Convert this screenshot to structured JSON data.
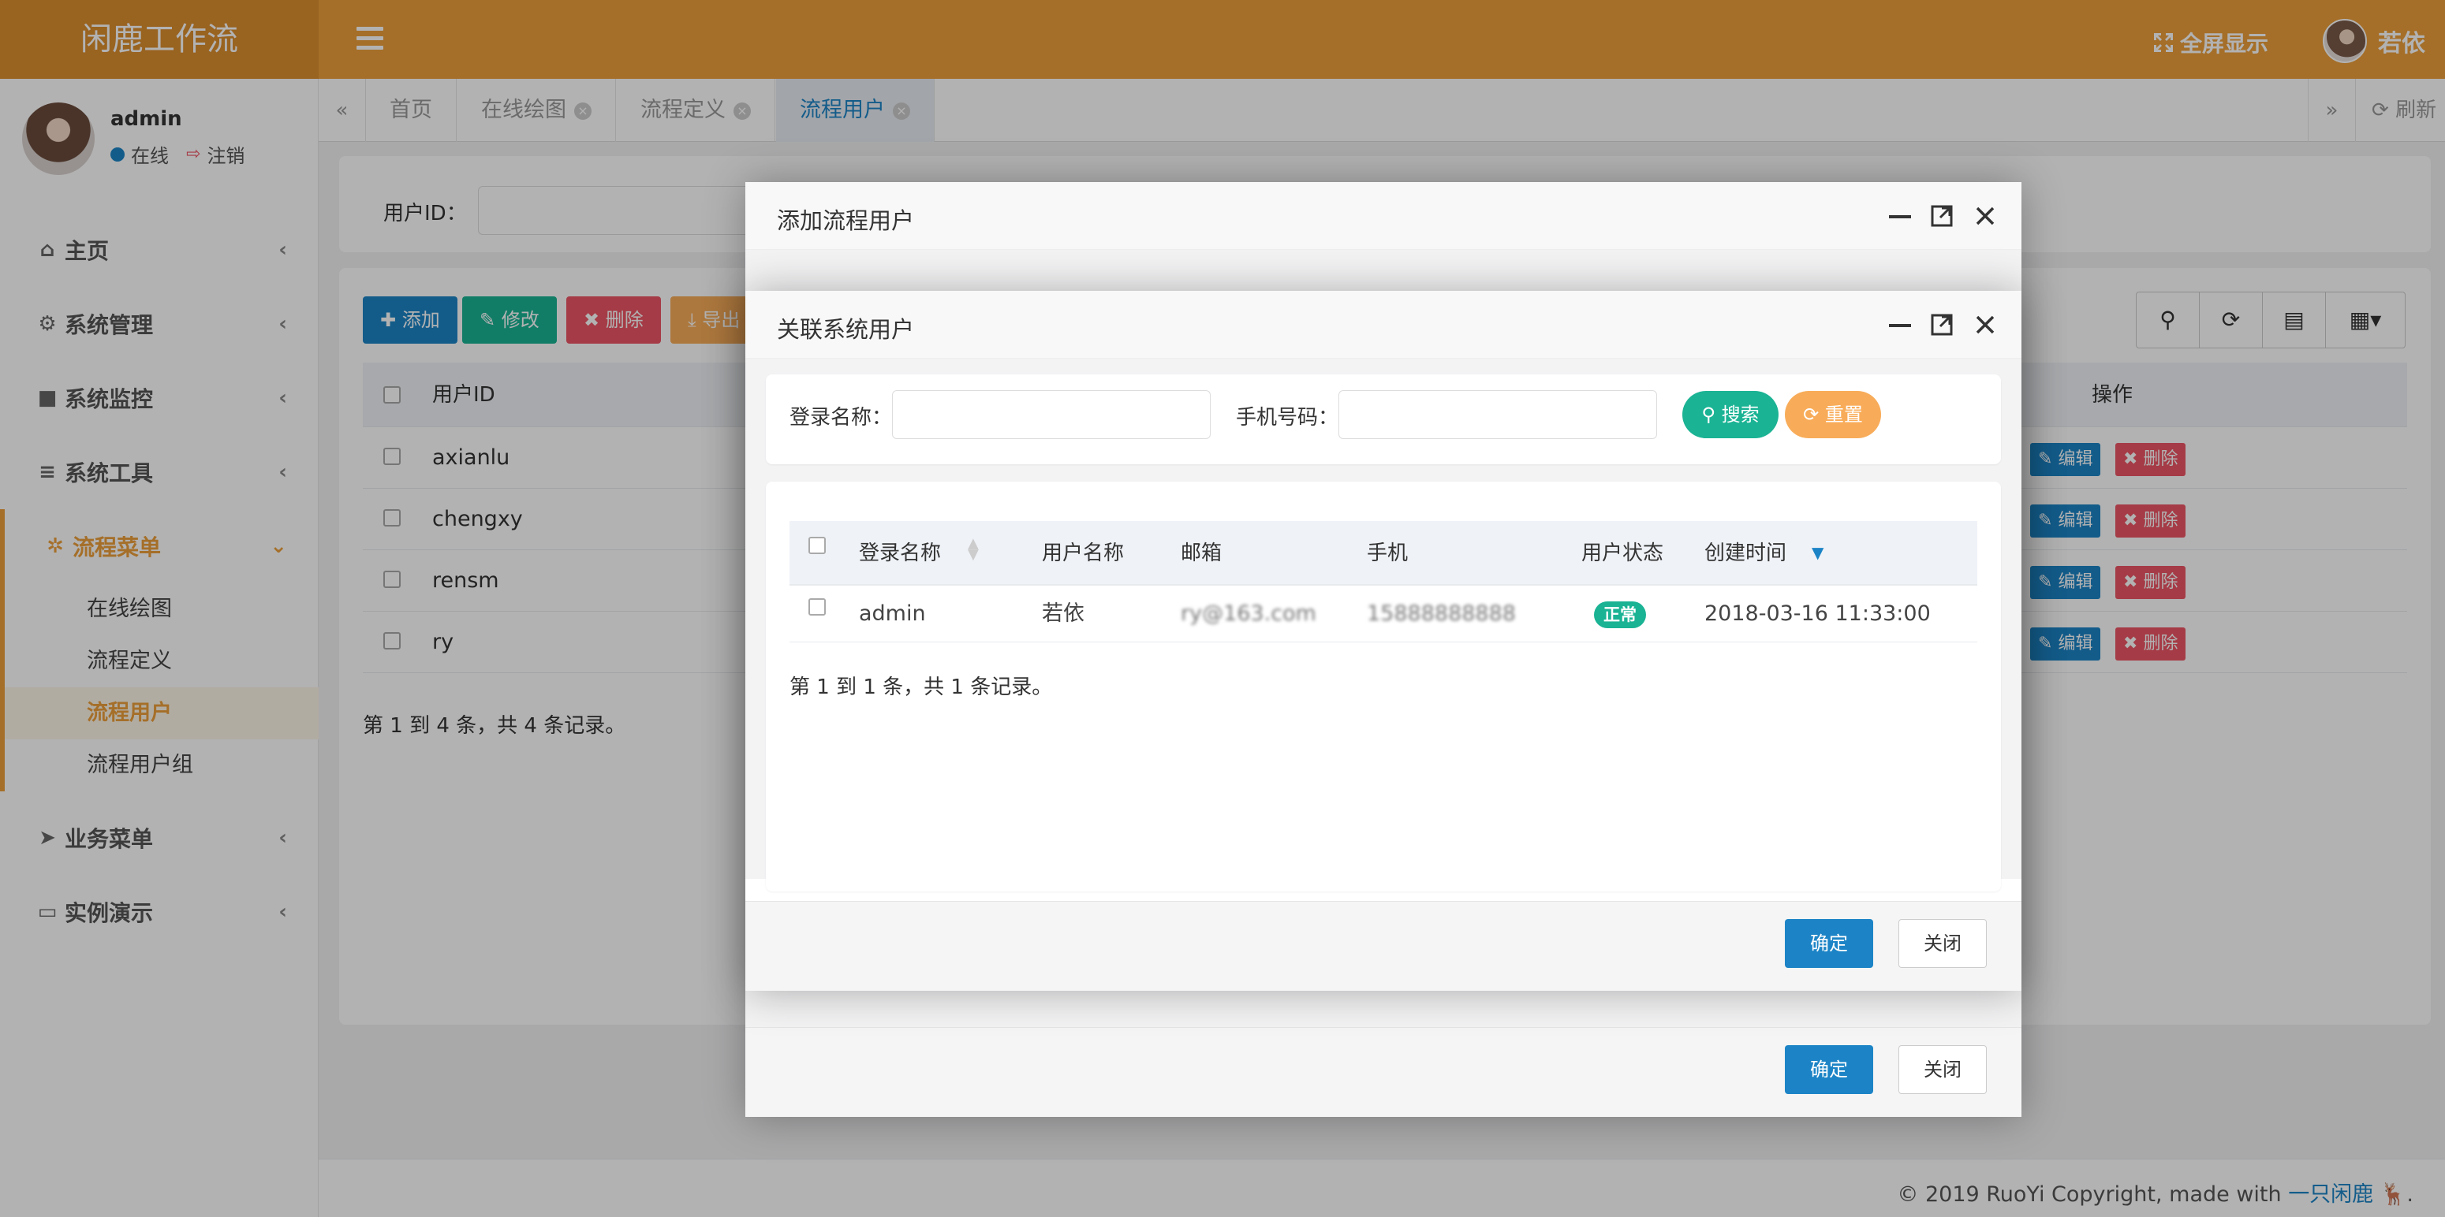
{
  "brand": "闲鹿工作流",
  "topbar": {
    "fullscreen_label": "全屏显示",
    "user_name": "若依"
  },
  "sidebar": {
    "user": {
      "name": "admin",
      "status": "在线",
      "logout": "注销"
    },
    "menu": [
      {
        "label": "主页",
        "icon": "home-icon"
      },
      {
        "label": "系统管理",
        "icon": "gear-icon"
      },
      {
        "label": "系统监控",
        "icon": "video-icon"
      },
      {
        "label": "系统工具",
        "icon": "bars-icon"
      },
      {
        "label": "流程菜单",
        "icon": "cogs-icon",
        "expanded": true,
        "children": [
          "在线绘图",
          "流程定义",
          "流程用户",
          "流程用户组"
        ],
        "current": "流程用户"
      },
      {
        "label": "业务菜单",
        "icon": "paper-plane-icon"
      },
      {
        "label": "实例演示",
        "icon": "desktop-icon"
      }
    ]
  },
  "tabs": [
    {
      "label": "首页",
      "closable": false
    },
    {
      "label": "在线绘图",
      "closable": true
    },
    {
      "label": "流程定义",
      "closable": true
    },
    {
      "label": "流程用户",
      "closable": true,
      "active": true
    }
  ],
  "tabbar": {
    "refresh_label": "刷新"
  },
  "background_page": {
    "search_label": "用户ID：",
    "toolbar": {
      "add": "添加",
      "edit": "修改",
      "delete": "删除",
      "export": "导出"
    },
    "columns": {
      "user_id": "用户ID",
      "actions": "操作"
    },
    "rows": [
      "axianlu",
      "chengxy",
      "rensm",
      "ry"
    ],
    "row_actions": {
      "edit": "编辑",
      "delete": "删除"
    },
    "pager": "第 1 到 4 条，共 4 条记录。"
  },
  "dialog_outer": {
    "title": "添加流程用户",
    "ok": "确定",
    "close": "关闭"
  },
  "dialog_inner": {
    "title": "关联系统用户",
    "search": {
      "login_label": "登录名称：",
      "login_value": "",
      "phone_label": "手机号码：",
      "phone_value": "",
      "search_btn": "搜索",
      "reset_btn": "重置"
    },
    "columns": {
      "login_name": "登录名称",
      "user_name": "用户名称",
      "email": "邮箱",
      "phone": "手机",
      "status": "用户状态",
      "created": "创建时间"
    },
    "rows": [
      {
        "login_name": "admin",
        "user_name": "若依",
        "email": "ry@163.com",
        "phone": "15888888888",
        "status": "正常",
        "created": "2018-03-16 11:33:00"
      }
    ],
    "pager": "第 1 到 1 条，共 1 条记录。",
    "ok": "确定",
    "close": "关闭"
  },
  "footer": {
    "copyright": "© 2019 RuoYi Copyright, made with ",
    "link": "一只闲鹿"
  },
  "colors": {
    "brand": "#ec9f3c",
    "primary": "#1c84c6",
    "success": "#1ab394",
    "danger": "#ed5565",
    "warning": "#f8ac59"
  }
}
